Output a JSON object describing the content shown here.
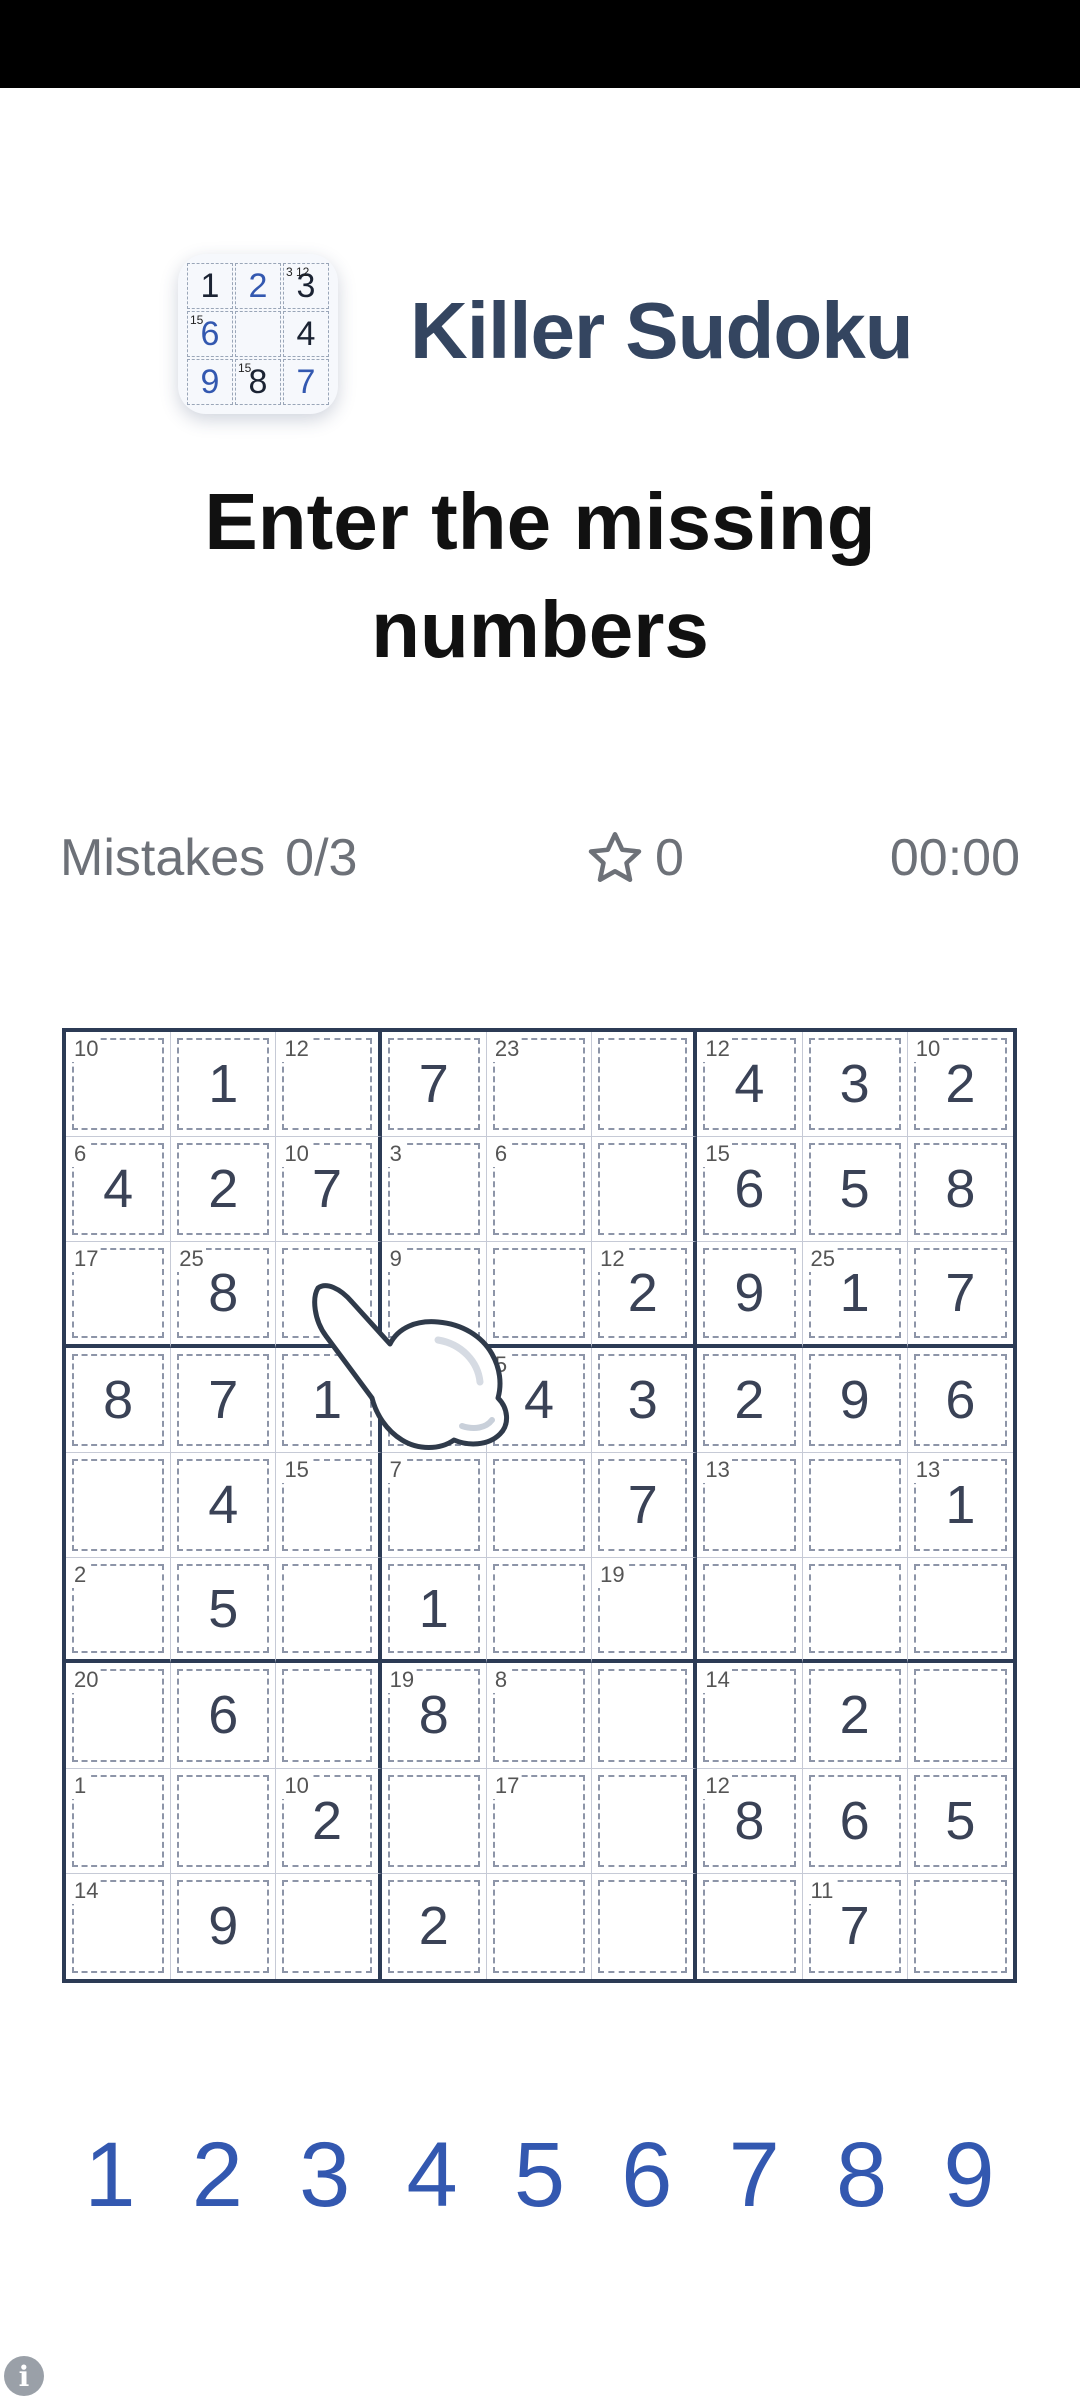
{
  "app": {
    "title": "Killer Sudoku",
    "icon_cells": [
      {
        "digit": "1",
        "cage": "",
        "blue": false
      },
      {
        "digit": "2",
        "cage": "",
        "blue": true
      },
      {
        "digit": "3",
        "cage": "3 12",
        "blue": false
      },
      {
        "digit": "6",
        "cage": "15",
        "blue": true
      },
      {
        "digit": "",
        "cage": "",
        "blue": false
      },
      {
        "digit": "4",
        "cage": "",
        "blue": false
      },
      {
        "digit": "9",
        "cage": "",
        "blue": true
      },
      {
        "digit": "8",
        "cage": "15",
        "blue": false
      },
      {
        "digit": "7",
        "cage": "",
        "blue": true
      }
    ]
  },
  "headline": {
    "line1": "Enter the missing",
    "line2": "numbers"
  },
  "stats": {
    "mistakes_label": "Mistakes",
    "mistakes_value": "0/3",
    "score": "0",
    "timer": "00:00"
  },
  "board": {
    "rows": [
      [
        "",
        "1",
        "",
        "7",
        "",
        "",
        "4",
        "3",
        "2"
      ],
      [
        "4",
        "2",
        "7",
        "",
        "",
        "",
        "6",
        "5",
        "8"
      ],
      [
        "",
        "8",
        "",
        "",
        "",
        "2",
        "9",
        "1",
        "7"
      ],
      [
        "8",
        "7",
        "1",
        "",
        "4",
        "3",
        "2",
        "9",
        "6"
      ],
      [
        "",
        "4",
        "",
        "",
        "",
        "7",
        "",
        "",
        "1"
      ],
      [
        "",
        "5",
        "",
        "1",
        "",
        "",
        "",
        "",
        ""
      ],
      [
        "",
        "6",
        "",
        "8",
        "",
        "",
        "",
        "2",
        ""
      ],
      [
        "",
        "",
        "2",
        "",
        "",
        "",
        "8",
        "6",
        "5"
      ],
      [
        "",
        "9",
        "",
        "2",
        "",
        "",
        "",
        "7",
        ""
      ]
    ],
    "cage_sums": [
      [
        "10",
        "",
        "12",
        "",
        "23",
        "",
        "12",
        "",
        "10"
      ],
      [
        "6",
        "",
        "10",
        "3",
        "6",
        "",
        "15",
        "",
        ""
      ],
      [
        "17",
        "25",
        "",
        "9",
        "",
        "12",
        "",
        "25",
        ""
      ],
      [
        "",
        "",
        "",
        "",
        "5",
        "",
        "",
        "",
        ""
      ],
      [
        "",
        "",
        "15",
        "7",
        "",
        "",
        "13",
        "",
        "13"
      ],
      [
        "2",
        "",
        "",
        "",
        "",
        "19",
        "",
        "",
        ""
      ],
      [
        "20",
        "",
        "",
        "19",
        "8",
        "",
        "14",
        "",
        ""
      ],
      [
        "1",
        "",
        "10",
        "",
        "17",
        "",
        "12",
        "",
        ""
      ],
      [
        "14",
        "",
        "",
        "",
        "",
        "",
        "",
        "11",
        ""
      ]
    ]
  },
  "numpad": [
    "1",
    "2",
    "3",
    "4",
    "5",
    "6",
    "7",
    "8",
    "9"
  ],
  "colors": {
    "accent": "#3358b0",
    "grid": "#2c3b55",
    "title": "#344560"
  }
}
